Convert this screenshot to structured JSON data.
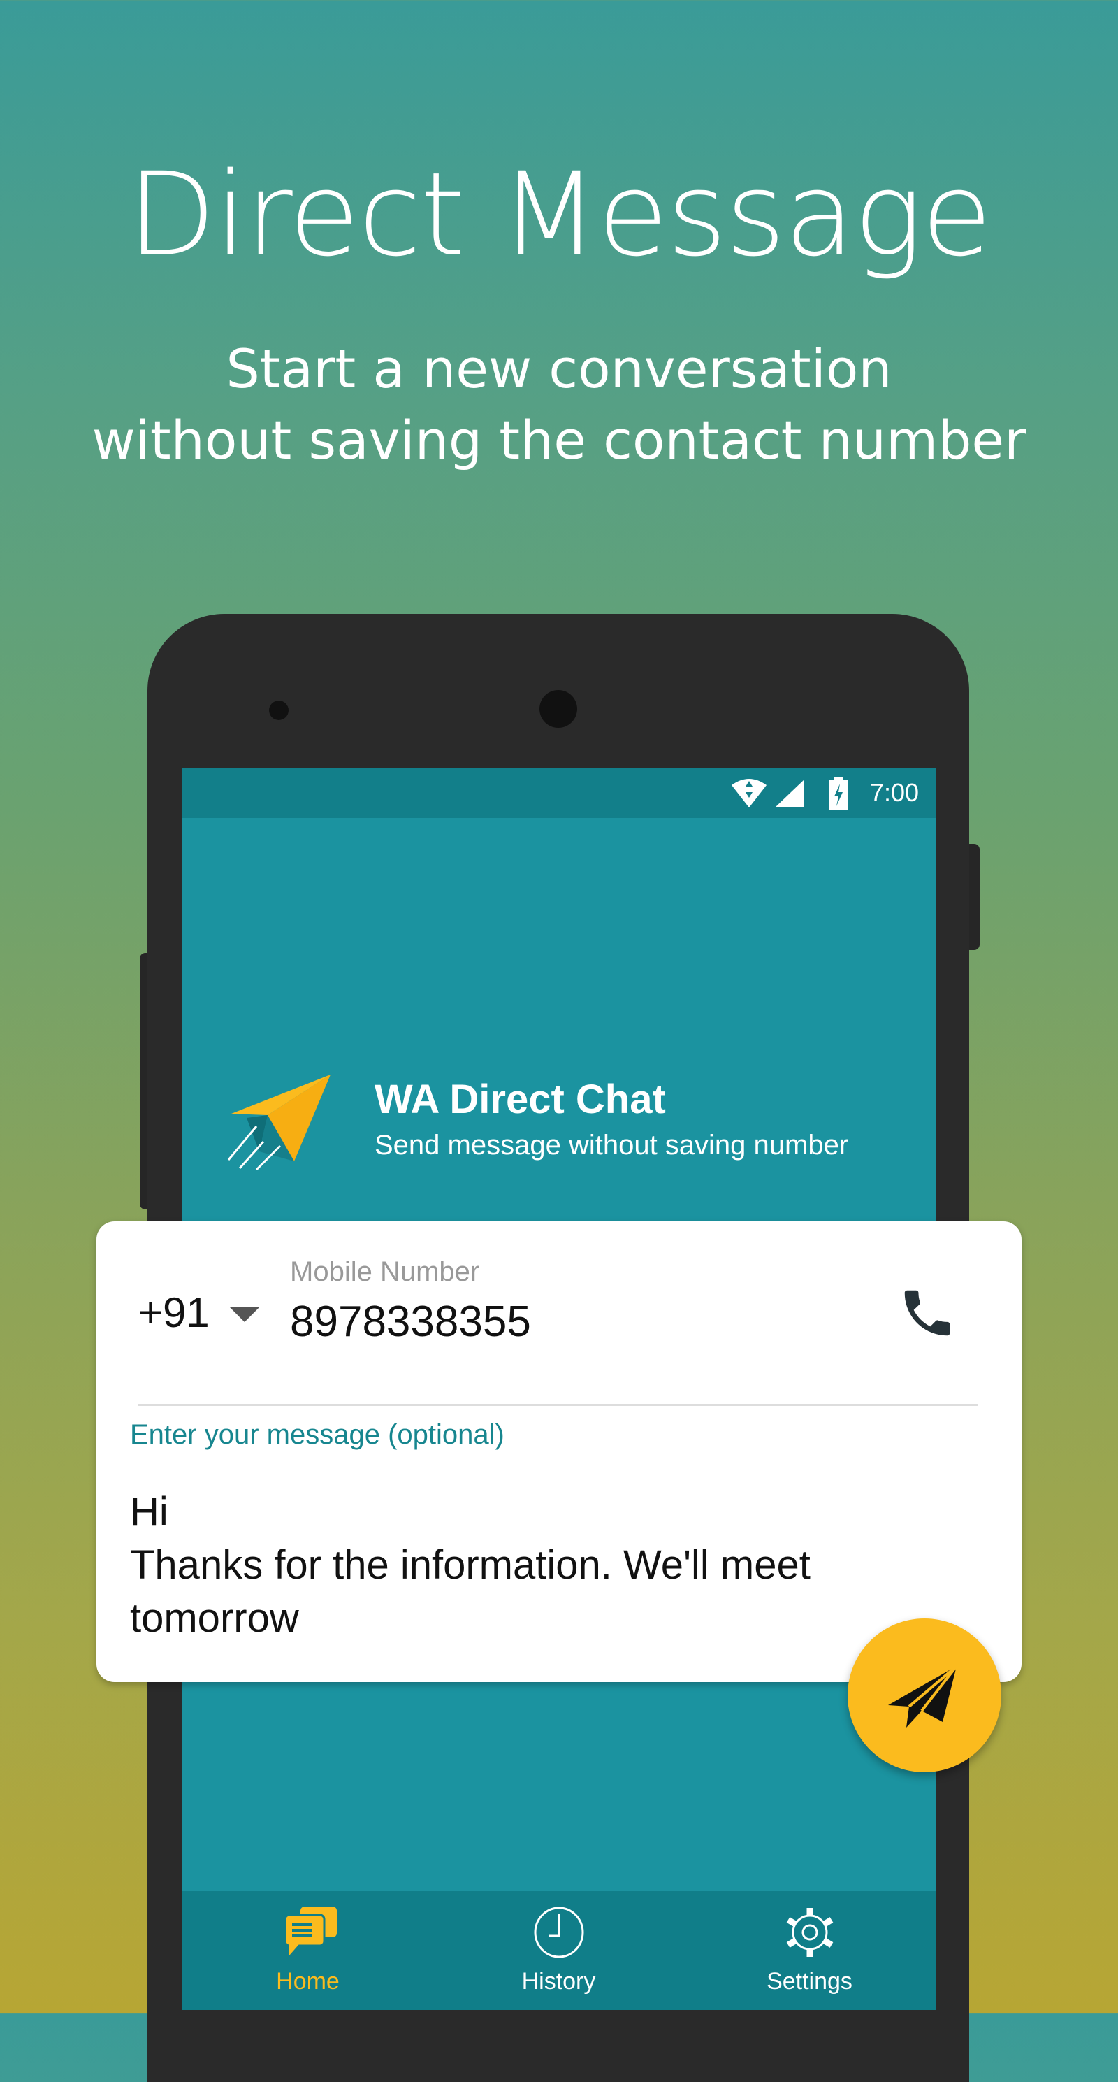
{
  "promo": {
    "title": "Direct Message",
    "subtitle_line1": "Start a new conversation",
    "subtitle_line2": "without saving the contact number"
  },
  "status_bar": {
    "time": "7:00",
    "icons": [
      "wifi-icon",
      "signal-icon",
      "battery-charging-icon"
    ]
  },
  "app_header": {
    "name": "WA Direct Chat",
    "tagline": "Send message without saving number",
    "logo": "paper-plane-logo"
  },
  "form": {
    "country_code": "+91",
    "mobile_label": "Mobile Number",
    "mobile_value": "8978338355",
    "message_label": "Enter your message (optional)",
    "message_lines": [
      "Hi",
      "Thanks for the information. We'll meet",
      "tomorrow"
    ]
  },
  "bottom_nav": {
    "items": [
      {
        "label": "Home",
        "icon": "chat-bubbles-icon",
        "active": true
      },
      {
        "label": "History",
        "icon": "clock-icon",
        "active": false
      },
      {
        "label": "Settings",
        "icon": "gear-icon",
        "active": false
      }
    ]
  },
  "colors": {
    "accent": "#fbbb1e",
    "primary": "#1b93a0",
    "primary_dark": "#107e89",
    "label_teal": "#17868f"
  }
}
